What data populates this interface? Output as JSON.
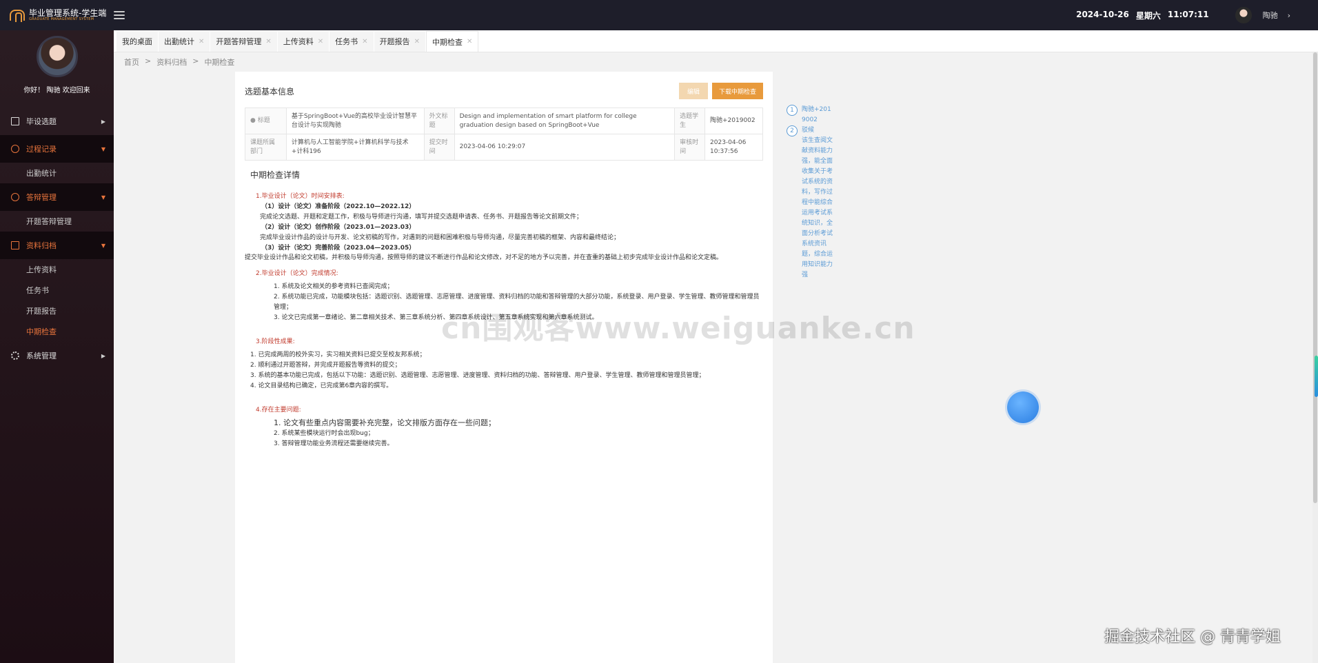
{
  "app": {
    "title": "毕业管理系统-学生端",
    "subtitle": "GRADUATE MANAGEMENT SYSTEM"
  },
  "header": {
    "date": "2024-10-26",
    "weekday": "星期六",
    "time": "11:07:11",
    "user": "陶驰"
  },
  "profile": {
    "welcome": "你好！ 陶驰 欢迎回来"
  },
  "menu": {
    "topic": "毕设选题",
    "process": "过程记录",
    "attendance": "出勤统计",
    "defense": "答辩管理",
    "defense_sub": "开题答辩管理",
    "archive": "资料归档",
    "archive_sub": [
      "上传资料",
      "任务书",
      "开题报告",
      "中期检查"
    ],
    "system": "系统管理"
  },
  "tabs": [
    "我的桌面",
    "出勤统计",
    "开题答辩管理",
    "上传资料",
    "任务书",
    "开题报告",
    "中期检查"
  ],
  "breadcrumb": {
    "home": "首页",
    "sep": ">",
    "level1": "资料归档",
    "level2": "中期检查"
  },
  "card": {
    "title": "选题基本信息",
    "edit_label": "编辑",
    "download_label": "下载中期检查",
    "table": {
      "title_label": "标题",
      "title_value": "基于SpringBoot+Vue的高校毕业设计智慧平台设计与实现陶驰",
      "en_label": "外文标题",
      "en_value": "Design and implementation of smart platform for college graduation design based on SpringBoot+Vue",
      "student_label": "选题学生",
      "student_value": "陶驰+2019002",
      "dept_label": "课题所属部门",
      "dept_value": "计算机与人工智能学院+计算机科学与技术+计科196",
      "submit_label": "提交时间",
      "submit_value": "2023-04-06 10:29:07",
      "review_label": "审核时间",
      "review_value": "2023-04-06 10:37:56"
    },
    "detail_title": "中期检查详情",
    "s1_title": "1.毕业设计（论文）时间安排表:",
    "s1_l1": "（1）设计（论文）准备阶段（2022.10—2022.12）",
    "s1_l2": "完成论文选题、开题和定题工作，积极与导师进行沟通，填写并提交选题申请表、任务书、开题报告等论文前期文件；",
    "s1_l3": "（2）设计（论文）创作阶段（2023.01—2023.03）",
    "s1_l4": "完成毕业设计作品的设计与开发、论文初稿的写作，对遇到的问题和困难积极与导师沟通，尽量完善初稿的框架、内容和最终结论；",
    "s1_l5": "（3）设计（论文）完善阶段（2023.04—2023.05）",
    "s1_l6": "提交毕业设计作品和论文初稿，并积极与导师沟通，按照导师的建议不断进行作品和论文修改，对不足的地方予以完善，并在查重的基础上初步完成毕业设计作品和论文定稿。",
    "s2_title": "2.毕业设计（论文）完成情况:",
    "s2_l1": "1. 系统及论文相关的参考资料已查阅完成；",
    "s2_l2": "2. 系统功能已完成，功能模块包括：选题识别、选题管理、志愿管理、进度管理、资料归档的功能和答辩管理的大部分功能，系统登录、用户登录、学生管理、教师管理和管理员管理；",
    "s2_l3": "3. 论文已完成第一章绪论、第二章相关技术、第三章系统分析、第四章系统设计、第五章系统实现和第六章系统测试。",
    "s3_title": "3.阶段性成果:",
    "s3_l1": "1.  已完成两周的校外实习，实习相关资料已提交至校友邦系统；",
    "s3_l2": "2.  顺利通过开题答辩，并完成开题报告等资料的提交；",
    "s3_l3": "3.  系统的基本功能已完成，包括以下功能：选题识别、选题管理、志愿管理、进度管理、资料归档的功能、答辩管理、用户登录、学生管理、教师管理和管理员管理；",
    "s3_l4": "4.  论文目录结构已确定，已完成第6章内容的撰写。",
    "s4_title": "4.存在主要问题:",
    "s4_l1": "1. 论文有些重点内容需要补充完整，论文排版方面存在一些问题；",
    "s4_l2": "2. 系统某些模块运行时会出现bug；",
    "s4_l3": "3. 答辩管理功能业务流程还需要继续完善。"
  },
  "timeline": {
    "step1_num": "1",
    "step1_text": "陶驰+2019002",
    "step2_num": "2",
    "step2_title": "驳候",
    "step2_text": "该生查阅文献资料能力强，能全面收集关于考试系统的资料，写作过程中能综合运用考试系统知识，全面分析考试系统资讯题，综合运用知识能力强"
  },
  "watermark": "cn围观客www.weiguanke.cn",
  "credit": "掘金技术社区 @ 青青学姐"
}
